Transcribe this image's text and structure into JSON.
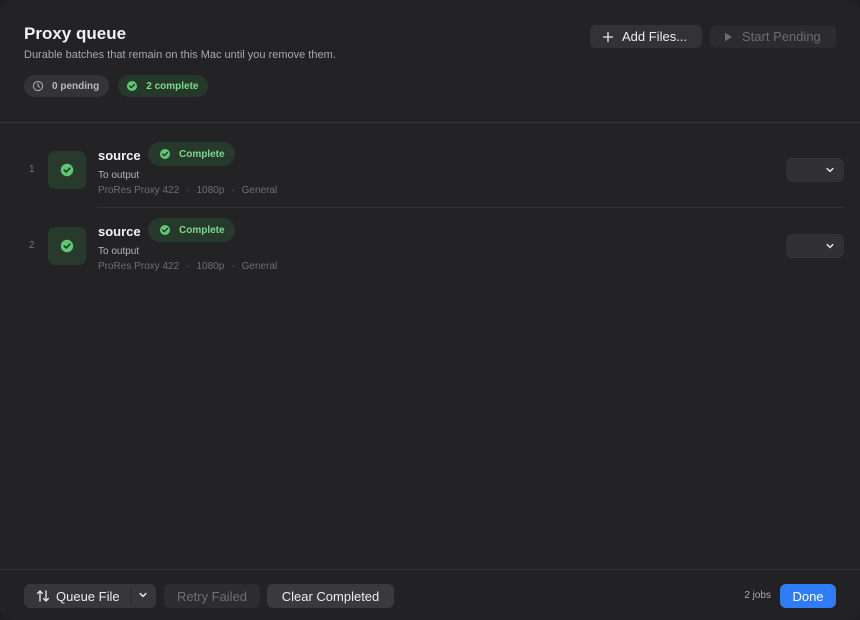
{
  "header": {
    "title": "Proxy queue",
    "subtitle": "Durable batches that remain on this Mac until you remove them.",
    "add_files_label": "Add Files...",
    "start_pending_label": "Start Pending"
  },
  "summary": {
    "pending_label": "0 pending",
    "complete_label": "2 complete"
  },
  "jobs": [
    {
      "index": "1",
      "name": "source",
      "status": "Complete",
      "destination": "To output",
      "codec": "ProRes Proxy 422",
      "resolution": "1080p",
      "preset": "General"
    },
    {
      "index": "2",
      "name": "source",
      "status": "Complete",
      "destination": "To output",
      "codec": "ProRes Proxy 422",
      "resolution": "1080p",
      "preset": "General"
    }
  ],
  "footer": {
    "queue_file_label": "Queue File",
    "retry_failed_label": "Retry Failed",
    "clear_completed_label": "Clear Completed",
    "job_count": "2 jobs",
    "done_label": "Done"
  },
  "icons": {
    "pending": "clock-icon",
    "complete": "check-circle-icon",
    "add": "plus-icon",
    "start": "play-icon",
    "queue": "swap-vertical-icon",
    "menu": "chevron-down-icon"
  },
  "colors": {
    "accent": "#2f7cf6",
    "success": "#7bd88f",
    "background": "#232325"
  }
}
